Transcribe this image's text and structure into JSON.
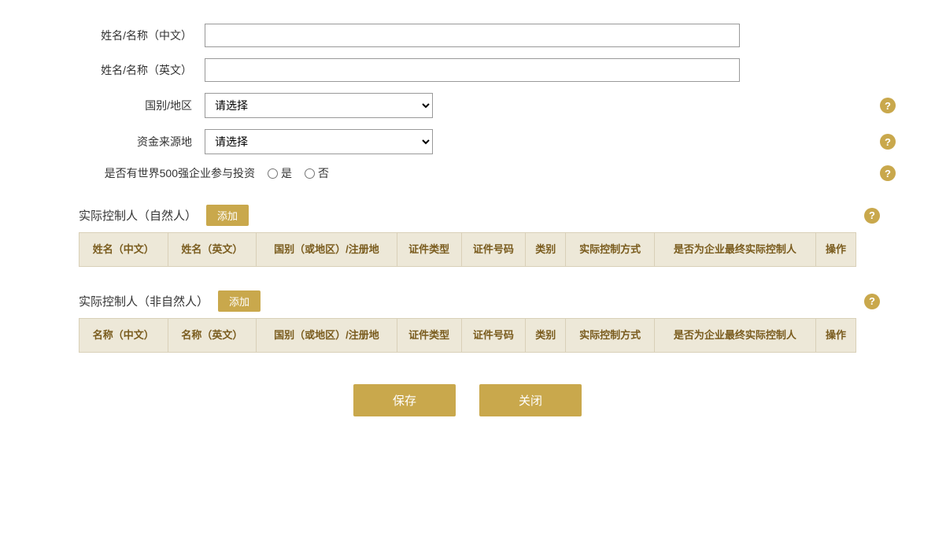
{
  "form": {
    "name_cn_label": "姓名/名称（中文）",
    "name_en_label": "姓名/名称（英文）",
    "country_label": "国别/地区",
    "country_placeholder": "请选择",
    "fund_source_label": "资金来源地",
    "fund_source_placeholder": "请选择",
    "fortune500_label": "是否有世界500强企业参与投资",
    "fortune500_yes": "是",
    "fortune500_no": "否"
  },
  "natural_person_section": {
    "title": "实际控制人（自然人）",
    "add_btn": "添加",
    "columns": [
      "姓名（中文）",
      "姓名（英文）",
      "国别（或地区）/注册地",
      "证件类型",
      "证件号码",
      "类别",
      "实际控制方式",
      "是否为企业最终实际控制人",
      "操作"
    ]
  },
  "non_natural_person_section": {
    "title": "实际控制人（非自然人）",
    "add_btn": "添加",
    "columns": [
      "名称（中文）",
      "名称（英文）",
      "国别（或地区）/注册地",
      "证件类型",
      "证件号码",
      "类别",
      "实际控制方式",
      "是否为企业最终实际控制人",
      "操作"
    ]
  },
  "buttons": {
    "save": "保存",
    "close": "关闭"
  },
  "help_icon_char": "?"
}
